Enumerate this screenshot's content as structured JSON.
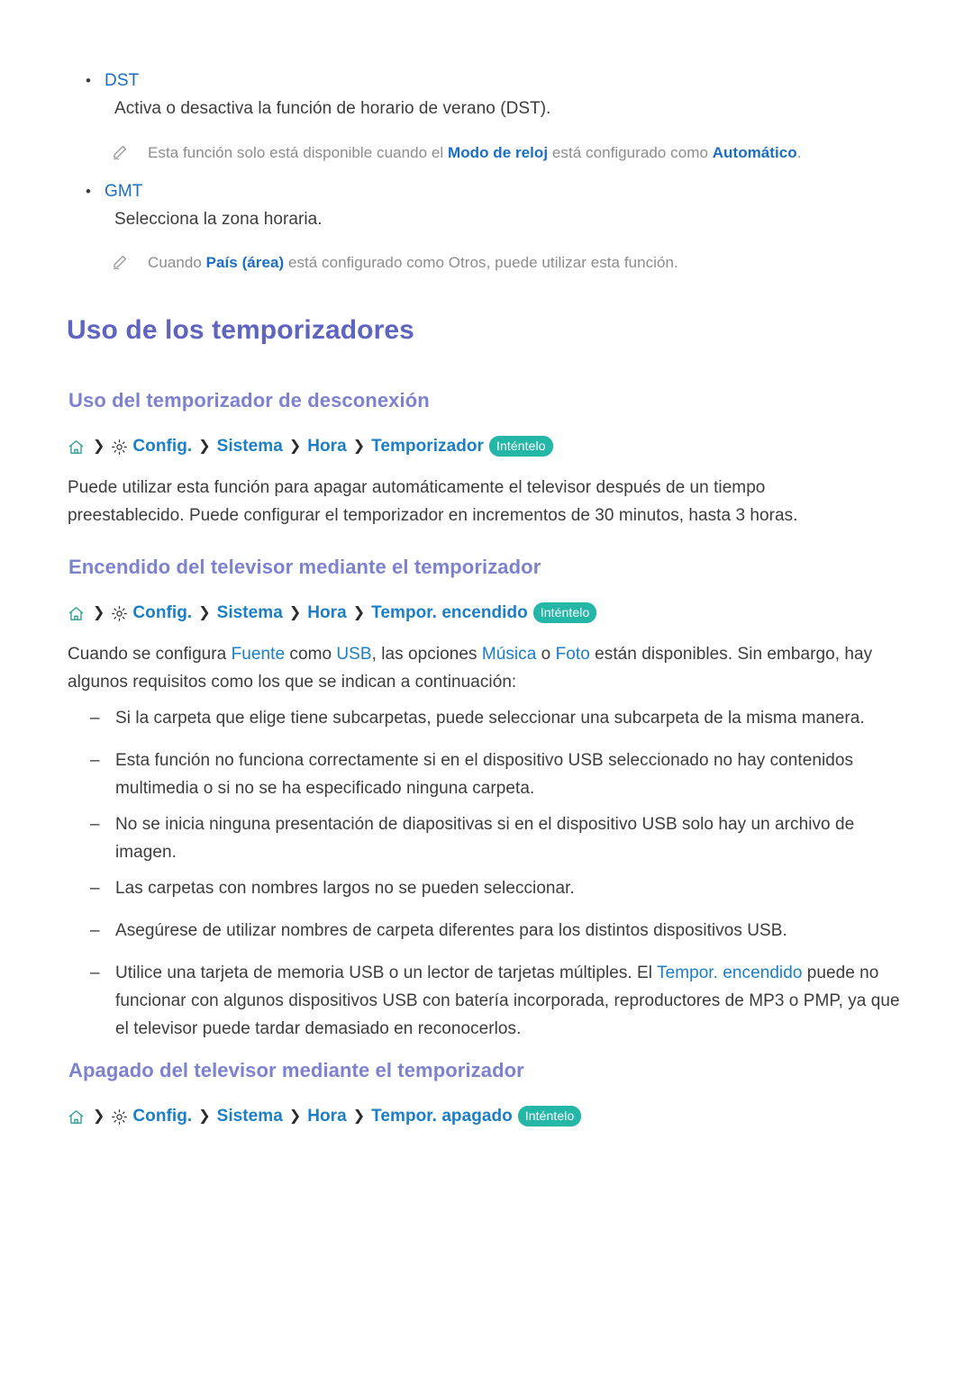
{
  "document": {
    "language": "es",
    "colors": {
      "body_text": "#3c3c3c",
      "link_blue": "#1b7ec6",
      "keyword_blue": "#1b6ec2",
      "title_purple": "#5f64c0",
      "subtitle_purple": "#7d82cf",
      "note_gray": "#8c8c8c",
      "badge_teal": "#24b6a6",
      "home_icon_teal": "#2a9d8f"
    }
  },
  "settings_items": [
    {
      "label": "DST",
      "description": "Activa o desactiva la función de horario de verano (DST).",
      "note": {
        "icon": "pencil-icon",
        "parts": [
          {
            "text": "Esta función solo está disponible cuando el ",
            "style": "plain"
          },
          {
            "text": "Modo de reloj",
            "style": "keyword"
          },
          {
            "text": " está configurado como ",
            "style": "plain"
          },
          {
            "text": "Automático",
            "style": "keyword"
          },
          {
            "text": ".",
            "style": "plain"
          }
        ]
      }
    },
    {
      "label": "GMT",
      "description": "Selecciona la zona horaria.",
      "note": {
        "icon": "pencil-icon",
        "parts": [
          {
            "text": "Cuando ",
            "style": "plain"
          },
          {
            "text": "País (área)",
            "style": "keyword"
          },
          {
            "text": " está configurado como Otros, puede utilizar esta función.",
            "style": "plain"
          }
        ]
      }
    }
  ],
  "main_title": "Uso de los temporizadores",
  "sections": [
    {
      "heading": "Uso del temporizador de desconexión",
      "breadcrumb": {
        "home_icon": "home-icon",
        "gear_icon": "gear-icon",
        "separator": "❯",
        "crumbs": [
          "Config.",
          "Sistema",
          "Hora",
          "Temporizador"
        ],
        "badge": "Inténtelo"
      },
      "paragraph": "Puede utilizar esta función para apagar automáticamente el televisor después de un tiempo preestablecido. Puede configurar el temporizador en incrementos de 30 minutos, hasta 3 horas."
    },
    {
      "heading": "Encendido del televisor mediante el temporizador",
      "breadcrumb": {
        "home_icon": "home-icon",
        "gear_icon": "gear-icon",
        "separator": "❯",
        "crumbs": [
          "Config.",
          "Sistema",
          "Hora",
          "Tempor. encendido"
        ],
        "badge": "Inténtelo"
      },
      "intro_parts": [
        {
          "text": "Cuando se configura ",
          "style": "plain"
        },
        {
          "text": "Fuente",
          "style": "link"
        },
        {
          "text": " como ",
          "style": "plain"
        },
        {
          "text": "USB",
          "style": "link"
        },
        {
          "text": ", las opciones ",
          "style": "plain"
        },
        {
          "text": "Música",
          "style": "link"
        },
        {
          "text": " o ",
          "style": "plain"
        },
        {
          "text": "Foto",
          "style": "link"
        },
        {
          "text": " están disponibles. Sin embargo, hay algunos requisitos como los que se indican a continuación:",
          "style": "plain"
        }
      ],
      "dash_marker": "–",
      "requirements": [
        {
          "parts": [
            {
              "text": "Si la carpeta que elige tiene subcarpetas, puede seleccionar una subcarpeta de la misma manera.",
              "style": "plain"
            }
          ]
        },
        {
          "parts": [
            {
              "text": "Esta función no funciona correctamente si en el dispositivo USB seleccionado no hay contenidos multimedia o si no se ha especificado ninguna carpeta.",
              "style": "plain"
            }
          ]
        },
        {
          "parts": [
            {
              "text": "No se inicia ninguna presentación de diapositivas si en el dispositivo USB solo hay un archivo de imagen.",
              "style": "plain"
            }
          ]
        },
        {
          "parts": [
            {
              "text": "Las carpetas con nombres largos no se pueden seleccionar.",
              "style": "plain"
            }
          ]
        },
        {
          "parts": [
            {
              "text": "Asegúrese de utilizar nombres de carpeta diferentes para los distintos dispositivos USB.",
              "style": "plain"
            }
          ]
        },
        {
          "parts": [
            {
              "text": "Utilice una tarjeta de memoria USB o un lector de tarjetas múltiples. El ",
              "style": "plain"
            },
            {
              "text": "Tempor. encendido",
              "style": "link"
            },
            {
              "text": " puede no funcionar con algunos dispositivos USB con batería incorporada, reproductores de MP3 o PMP, ya que el televisor puede tardar demasiado en reconocerlos.",
              "style": "plain"
            }
          ]
        }
      ]
    },
    {
      "heading": "Apagado del televisor mediante el temporizador",
      "breadcrumb": {
        "home_icon": "home-icon",
        "gear_icon": "gear-icon",
        "separator": "❯",
        "crumbs": [
          "Config.",
          "Sistema",
          "Hora",
          "Tempor. apagado"
        ],
        "badge": "Inténtelo"
      }
    }
  ]
}
